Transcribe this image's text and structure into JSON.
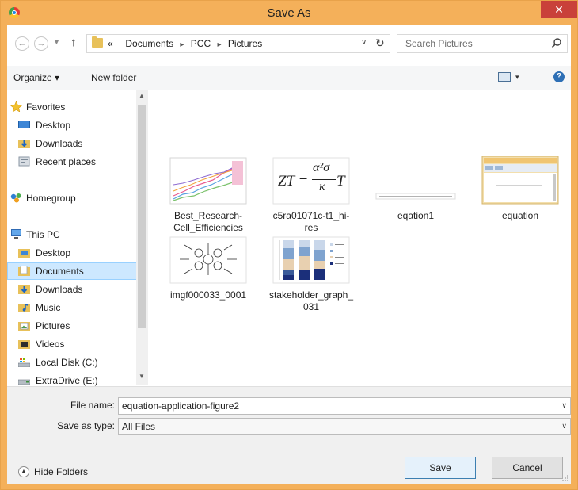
{
  "window": {
    "title": "Save As",
    "close_glyph": "✕",
    "accent": "#f4b05a"
  },
  "nav": {
    "back": "←",
    "forward": "→",
    "recent": "▼",
    "up": "↑"
  },
  "address": {
    "prefix": "«",
    "crumbs": [
      "Documents",
      "PCC",
      "Pictures"
    ],
    "separator": "▸",
    "dropdown": "∨",
    "refresh": "↻"
  },
  "search": {
    "placeholder": "Search Pictures"
  },
  "toolbar": {
    "organize": "Organize ▾",
    "new_folder": "New folder",
    "view_dropdown": "▾",
    "help": "?"
  },
  "sidebar": {
    "items": [
      {
        "label": "Favorites",
        "icon": "star-icon"
      },
      {
        "label": "Desktop",
        "icon": "desktop-icon"
      },
      {
        "label": "Downloads",
        "icon": "downloads-icon"
      },
      {
        "label": "Recent places",
        "icon": "recent-places-icon"
      },
      {
        "label": "Homegroup",
        "icon": "homegroup-icon"
      },
      {
        "label": "This PC",
        "icon": "computer-icon"
      },
      {
        "label": "Desktop",
        "icon": "desktop-folder-icon"
      },
      {
        "label": "Documents",
        "icon": "documents-icon",
        "selected": true
      },
      {
        "label": "Downloads",
        "icon": "downloads-icon"
      },
      {
        "label": "Music",
        "icon": "music-icon"
      },
      {
        "label": "Pictures",
        "icon": "pictures-icon"
      },
      {
        "label": "Videos",
        "icon": "videos-icon"
      },
      {
        "label": "Local Disk (C:)",
        "icon": "drive-icon"
      },
      {
        "label": "ExtraDrive (E:)",
        "icon": "drive-icon"
      }
    ]
  },
  "files": [
    {
      "name": "Best_Research-Cell_Efficiencies"
    },
    {
      "name": "c5ra01071c-t1_hi-res",
      "formula": {
        "lhs": "ZT =",
        "num": "α²σ",
        "den": "κ",
        "rhs": "T"
      }
    },
    {
      "name": "eqation1"
    },
    {
      "name": "equation"
    },
    {
      "name": "imgf000033_0001"
    },
    {
      "name": "stakeholder_graph_031"
    }
  ],
  "form": {
    "file_name_label": "File name:",
    "file_name_value": "equation-application-figure2",
    "save_type_label": "Save as type:",
    "save_type_value": "All Files"
  },
  "footer": {
    "hide_folders": "Hide Folders",
    "save": "Save",
    "cancel": "Cancel"
  }
}
